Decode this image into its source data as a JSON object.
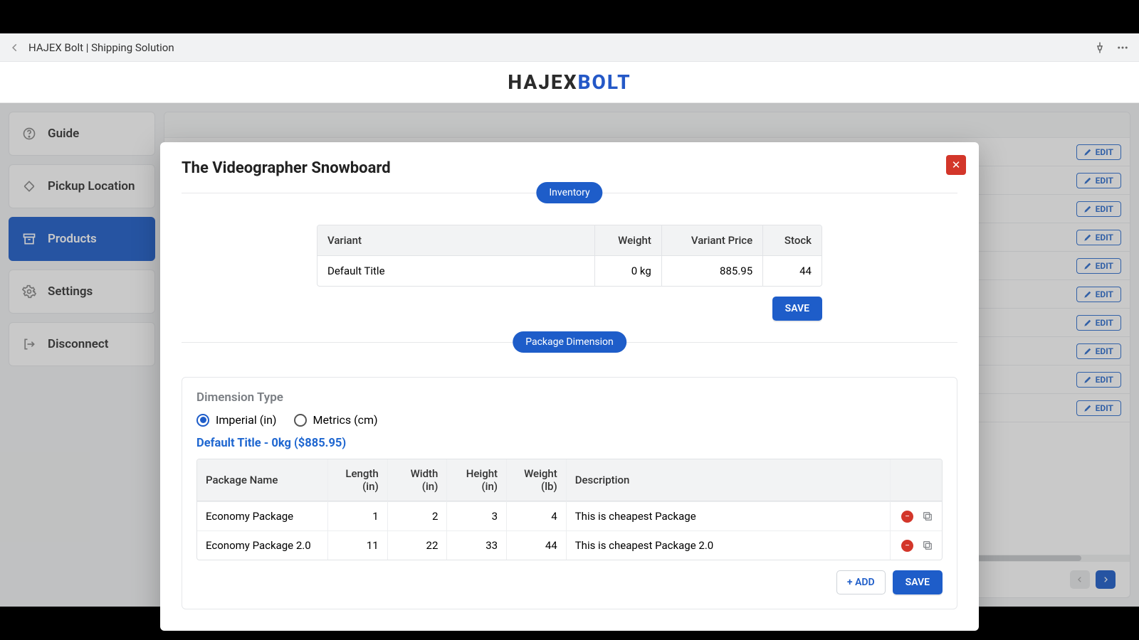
{
  "titlebar": {
    "text": "HAJEX Bolt | Shipping Solution"
  },
  "brand": {
    "part1": "HAJEX",
    "part2": "BOLT"
  },
  "sidebar": {
    "items": [
      {
        "label": "Guide"
      },
      {
        "label": "Pickup Location"
      },
      {
        "label": "Products"
      },
      {
        "label": "Settings"
      },
      {
        "label": "Disconnect"
      }
    ]
  },
  "editLabel": "EDIT",
  "modal": {
    "title": "The Videographer Snowboard",
    "inventoryPill": "Inventory",
    "saveLabel": "SAVE",
    "invHeaders": {
      "variant": "Variant",
      "weight": "Weight",
      "price": "Variant Price",
      "stock": "Stock"
    },
    "invRow": {
      "variant": "Default Title",
      "weight": "0 kg",
      "price": "885.95",
      "stock": "44"
    },
    "pkgPill": "Package Dimension",
    "dimTypeLabel": "Dimension Type",
    "radios": {
      "imperial": "Imperial (in)",
      "metric": "Metrics (cm)"
    },
    "variantLink": "Default Title - 0kg ($885.95)",
    "pkgHeaders": {
      "name": "Package Name",
      "length": "Length (in)",
      "width": "Width (in)",
      "height": "Height (in)",
      "weight": "Weight (lb)",
      "desc": "Description"
    },
    "pkgRows": [
      {
        "name": "Economy Package",
        "length": "1",
        "width": "2",
        "height": "3",
        "weight": "4",
        "desc": "This is cheapest Package"
      },
      {
        "name": "Economy Package 2.0",
        "length": "11",
        "width": "22",
        "height": "33",
        "weight": "44",
        "desc": "This is cheapest Package 2.0"
      }
    ],
    "addLabel": "+ ADD",
    "save2Label": "SAVE"
  }
}
